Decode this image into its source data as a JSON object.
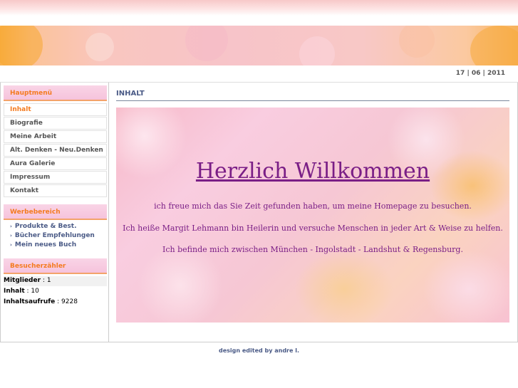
{
  "date": "17 | 06 | 2011",
  "sidebar": {
    "main_menu_title": "Hauptmenü",
    "main_menu": [
      "Inhalt",
      "Biografie",
      "Meine Arbeit",
      "Alt. Denken - Neu.Denken",
      "Aura Galerie",
      "Impressum",
      "Kontakt"
    ],
    "ads_title": "Werbebereich",
    "ads_links": [
      "Produkte & Best.",
      "Bücher Empfehlungen",
      "Mein neues Buch"
    ],
    "counter_title": "Besucherzähler",
    "stats": [
      {
        "label": "Mitglieder",
        "value": ": 1"
      },
      {
        "label": "Inhalt",
        "value": ": 10"
      },
      {
        "label": "Inhaltsaufrufe",
        "value": ": 9228"
      }
    ]
  },
  "content": {
    "title": "INHALT",
    "welcome_title": "Herzlich Willkommen",
    "lines": [
      "ich freue mich das Sie Zeit gefunden haben, um meine Homepage zu besuchen.",
      "Ich heiße Margit Lehmann bin Heilerin und versuche Menschen in jeder Art & Weise zu helfen.",
      "Ich befinde mich zwischen München - Ingolstadt - Landshut & Regensburg."
    ]
  },
  "footer": "design edited by andre l.",
  "colors": {
    "accent": "#f47b20",
    "link": "#4a5a86",
    "welcome_text": "#7a1e86"
  }
}
